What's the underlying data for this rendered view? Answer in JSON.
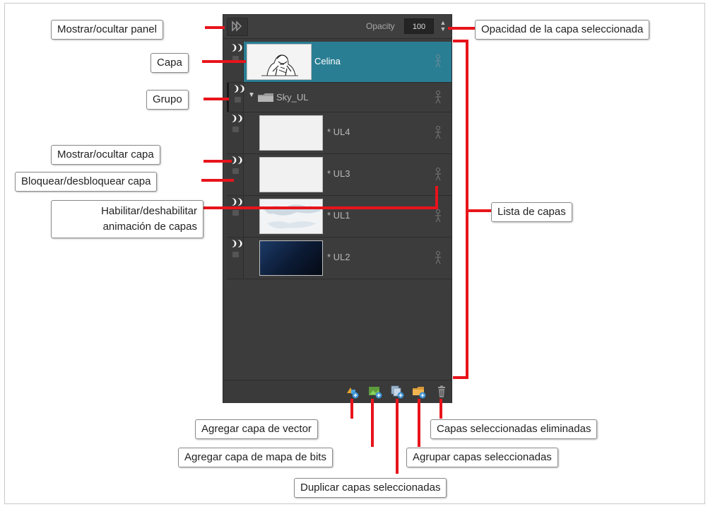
{
  "panel": {
    "opacity_label": "Opacity",
    "opacity_value": "100"
  },
  "layers": [
    {
      "name": "Celina",
      "selected": true
    },
    {
      "name": "Sky_UL",
      "group": true
    },
    {
      "name": "* UL4"
    },
    {
      "name": "* UL3"
    },
    {
      "name": "* UL1"
    },
    {
      "name": "* UL2"
    }
  ],
  "callouts": {
    "show_panel": "Mostrar/ocultar panel",
    "layer": "Capa",
    "group": "Grupo",
    "show_layer": "Mostrar/ocultar capa",
    "lock_layer": "Bloquear/desbloquear capa",
    "enable_anim_1": "Habilitar/deshabilitar",
    "enable_anim_2": "animación de capas",
    "opacity": "Opacidad de la capa seleccionada",
    "layer_list": "Lista de capas",
    "add_vector": "Agregar capa de vector",
    "add_bitmap": "Agregar capa de mapa de bits",
    "duplicate": "Duplicar capas seleccionadas",
    "group_selected": "Agrupar capas seleccionadas",
    "delete_selected": "Capas seleccionadas eliminadas"
  },
  "colors": {
    "accent_selected": "#2a7e94",
    "callout_line": "#e8141b",
    "panel_bg": "#3c3c3c"
  },
  "icons": [
    "double-chevron-icon",
    "eye-icon",
    "lock-icon",
    "folder-icon",
    "animation-figure-icon",
    "add-vector-layer-icon",
    "add-bitmap-layer-icon",
    "duplicate-layers-icon",
    "group-layers-icon",
    "trash-icon"
  ]
}
